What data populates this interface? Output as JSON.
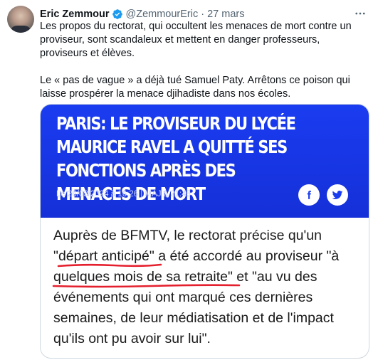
{
  "tweet": {
    "author_name": "Eric Zemmour",
    "handle": "@ZemmourEric",
    "separator": "·",
    "date": "27 mars",
    "more_icon": "more-horizontal-icon",
    "paragraph1": "Les propos du rectorat, qui occultent les menaces de mort contre un proviseur, sont scandaleux et mettent en danger professeurs, proviseurs et élèves.",
    "paragraph2": "Le « pas de vague » a déjà tué Samuel Paty. Arrêtons ce poison qui laisse prospérer la menace djihadiste dans nos écoles."
  },
  "card": {
    "headline": "PARIS: LE PROVISEUR DU LYCÉE MAURICE RAVEL A QUITTÉ SES FONCTIONS APRÈS DES MENACES DE MORT",
    "meta": "Le 26/03/2024 à 16:26  | MAJ à 21:45",
    "banner_color": "#1a3cf0",
    "underline_color": "#e5202e",
    "quote": {
      "part1": "Auprès de BFMTV, le rectorat précise qu'un \"",
      "highlight1": "départ anticipé",
      "part2": "\" a été accordé au proviseur \"à ",
      "highlight2": "quelques mois de sa retraite",
      "part3": "\" et \"au vu des événements qui ont marqué ces dernières semaines, de leur médiatisation et de l'impact qu'ils ont pu avoir sur lui\"."
    },
    "social": [
      "facebook-icon",
      "twitter-icon"
    ]
  }
}
